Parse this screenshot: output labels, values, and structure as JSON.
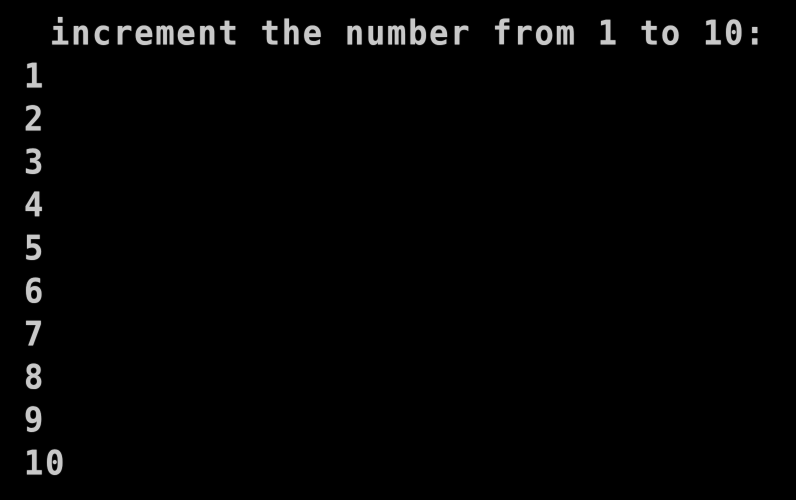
{
  "console": {
    "background": "#000000",
    "foreground": "#c8c8c8",
    "header": "increment the number from 1 to 10:",
    "output_lines": [
      "1",
      "2",
      "3",
      "4",
      "5",
      "6",
      "7",
      "8",
      "9",
      "10"
    ]
  }
}
